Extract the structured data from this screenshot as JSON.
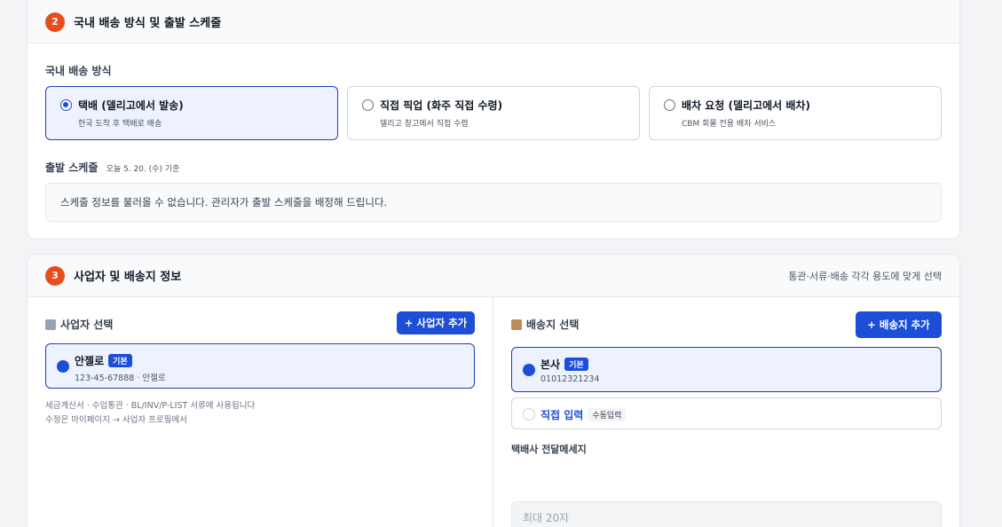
{
  "section2": {
    "step": "2",
    "title": "국내 배송 방식 및 출발 스케줄",
    "method_label": "국내 배송 방식",
    "options": [
      {
        "title": "택배 (델리고에서 발송)",
        "desc": "한국 도착 후 택배로 배송"
      },
      {
        "title": "직접 픽업 (화주 직접 수령)",
        "desc": "델리고 창고에서 직접 수령"
      },
      {
        "title": "배차 요청 (델리고에서 배차)",
        "desc": "CBM 회물 전용 배차 서비스"
      }
    ],
    "schedule_label": "출발 스케줄",
    "schedule_date": "오늘 5. 20. (수) 기준",
    "schedule_message": "스케줄 정보를 불러올 수 없습니다. 관리자가 출발 스케줄을 배정해 드립니다."
  },
  "section3": {
    "step": "3",
    "title": "사업자 및 배송지 정보",
    "subtitle": "통관·서류·배송 각각 용도에 맞게 선택",
    "business": {
      "title": "사업자 선택",
      "add_button": "+ 사업자 추가",
      "name": "안젤로",
      "badge": "기본",
      "info": "123-45-67888 · 안젤로",
      "note1": "세금계산서 · 수입통관 · BL/INV/P-LIST 서류에 사용됩니다",
      "note2": "수정은 마이페이지 → 사업자 프로필에서"
    },
    "address": {
      "title": "배송지 선택",
      "add_button": "+ 배송지 추가",
      "name": "본사",
      "badge": "기본",
      "phone": "01012321234",
      "manual_label": "직접 입력",
      "manual_badge": "수동입력",
      "message_label": "택배사 전달메세지",
      "message_placeholder": "최대 20자"
    }
  },
  "colors": {
    "accent": "#1d4ed8",
    "step": "#e84e1b"
  }
}
